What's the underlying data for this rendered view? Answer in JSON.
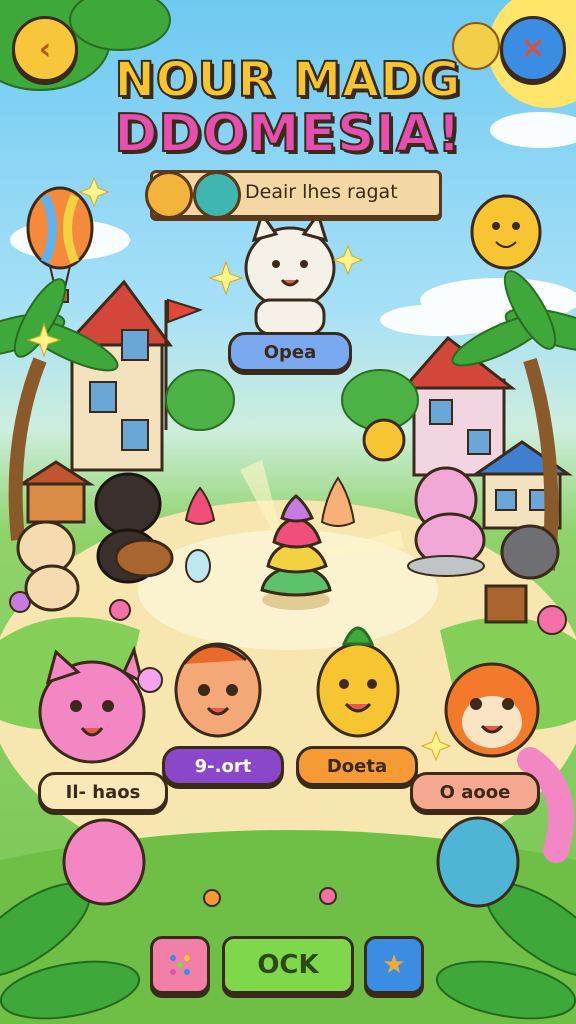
{
  "title": {
    "line1": "NOUR MADG",
    "line2": "DDOMESIA!"
  },
  "subtitle_banner": {
    "text": "Deair lhes ragat"
  },
  "hero": {
    "label": "Opea"
  },
  "characters": [
    {
      "label": "Il- haos"
    },
    {
      "label": "9-.ort"
    },
    {
      "label": "Doeta"
    },
    {
      "label": "O aooe"
    }
  ],
  "footer": {
    "ok_label": "OCK"
  },
  "icons": {
    "back": "chevron-left-icon",
    "close": "close-icon",
    "coin": "coin-icon",
    "dice": "dice-icon",
    "star": "star-icon"
  },
  "colors": {
    "sky": "#6ec9f2",
    "grass": "#8fd36a",
    "path": "#f7e6b0",
    "title_yellow": "#f6c531",
    "title_pink": "#e64fae",
    "accent_blue": "#3b8de3",
    "accent_green": "#7fd84c"
  }
}
